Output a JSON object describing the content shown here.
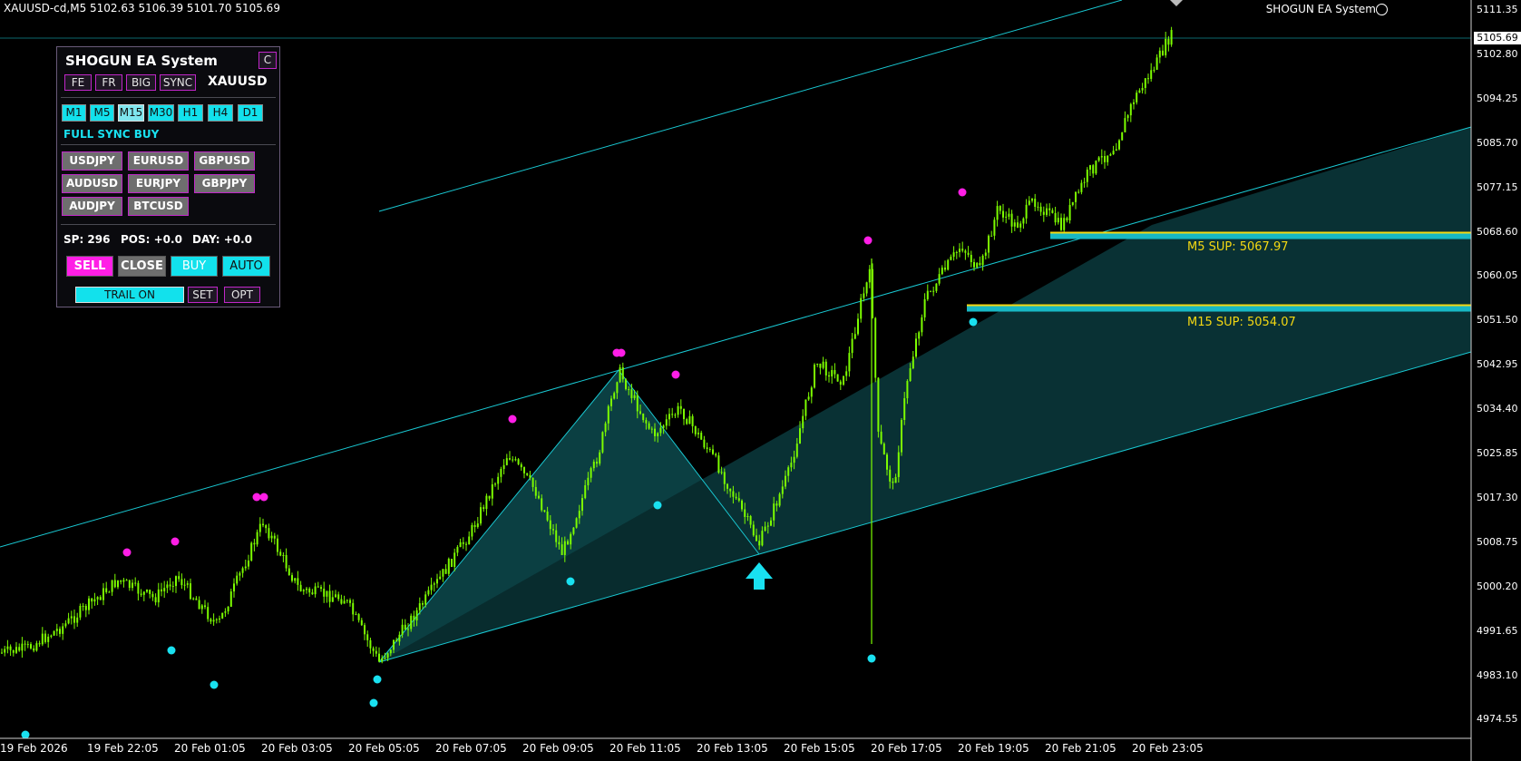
{
  "window": {
    "symbol_header": "XAUUSD-cd,M5  5102.63 5106.39 5101.70 5105.69",
    "ea_name": "SHOGUN EA System",
    "current_price": "5105.69"
  },
  "y_axis_labels": [
    "5111.35",
    "5102.80",
    "5094.25",
    "5085.70",
    "5077.15",
    "5068.60",
    "5060.05",
    "5051.50",
    "5042.95",
    "5034.40",
    "5025.85",
    "5017.30",
    "5008.75",
    "5000.20",
    "4991.65",
    "4983.10",
    "4974.55"
  ],
  "x_axis_labels": [
    "19 Feb 2026",
    "19 Feb 22:05",
    "20 Feb 01:05",
    "20 Feb 03:05",
    "20 Feb 05:05",
    "20 Feb 07:05",
    "20 Feb 09:05",
    "20 Feb 11:05",
    "20 Feb 13:05",
    "20 Feb 15:05",
    "20 Feb 17:05",
    "20 Feb 19:05",
    "20 Feb 21:05",
    "20 Feb 23:05"
  ],
  "support_levels": [
    {
      "label": "M5 SUP: 5067.97",
      "price": 5067.97
    },
    {
      "label": "M15 SUP: 5054.07",
      "price": 5054.07
    }
  ],
  "colors": {
    "candle": "#7cfc00",
    "channel": "#19c8d2",
    "sell_marker": "#ff1ee6",
    "buy_marker": "#19e1f0",
    "support": "#f4d812",
    "support_fill": "#18b8c4"
  },
  "panel": {
    "title": "SHOGUN EA System",
    "close_small": "C",
    "toggles": [
      "FE",
      "FR",
      "BIG",
      "SYNC"
    ],
    "symbol": "XAUUSD",
    "timeframes": [
      "M1",
      "M5",
      "M15",
      "M30",
      "H1",
      "H4",
      "D1"
    ],
    "active_timeframe": "M15",
    "sync_status": "FULL SYNC BUY",
    "pairs": [
      "USDJPY",
      "EURUSD",
      "GBPUSD",
      "AUDUSD",
      "EURJPY",
      "GBPJPY",
      "AUDJPY",
      "BTCUSD"
    ],
    "sp": "SP: 296",
    "pos": "POS: +0.0",
    "day": "DAY: +0.0",
    "sell": "SELL",
    "close": "CLOSE",
    "buy": "BUY",
    "auto": "AUTO",
    "trail": "TRAIL ON",
    "set": "SET",
    "opt": "OPT"
  }
}
